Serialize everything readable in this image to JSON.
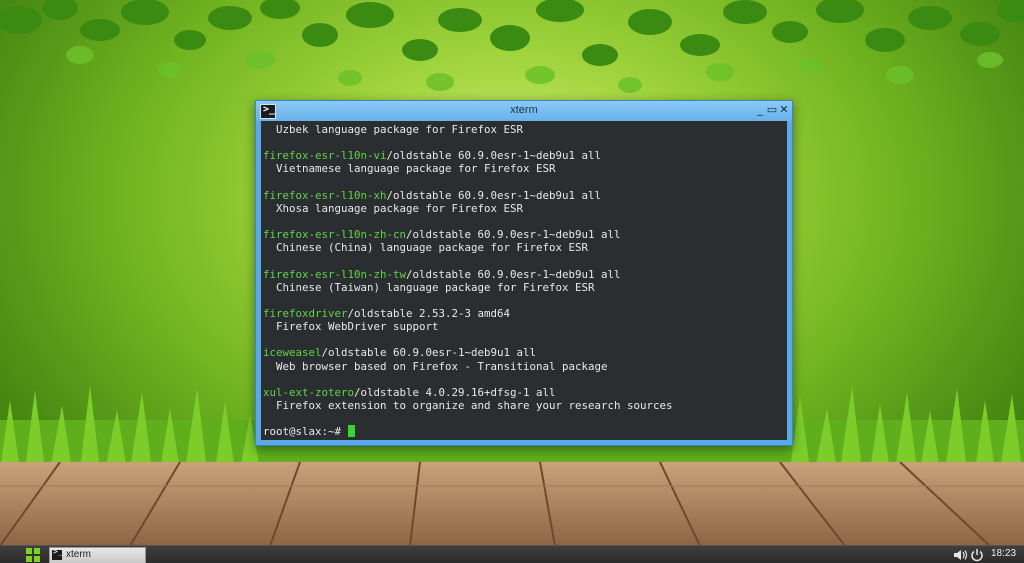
{
  "window": {
    "title": "xterm",
    "controls": {
      "minimize": "_",
      "maximize": "▭",
      "close": "✕"
    },
    "title_icon": "terminal-icon"
  },
  "terminal": {
    "lines": [
      {
        "pkg": "",
        "rest": "  Uzbek language package for Firefox ESR"
      },
      {
        "pkg": "",
        "rest": ""
      },
      {
        "pkg": "firefox-esr-l10n-vi",
        "rest": "/oldstable 60.9.0esr-1~deb9u1 all"
      },
      {
        "pkg": "",
        "rest": "  Vietnamese language package for Firefox ESR"
      },
      {
        "pkg": "",
        "rest": ""
      },
      {
        "pkg": "firefox-esr-l10n-xh",
        "rest": "/oldstable 60.9.0esr-1~deb9u1 all"
      },
      {
        "pkg": "",
        "rest": "  Xhosa language package for Firefox ESR"
      },
      {
        "pkg": "",
        "rest": ""
      },
      {
        "pkg": "firefox-esr-l10n-zh-cn",
        "rest": "/oldstable 60.9.0esr-1~deb9u1 all"
      },
      {
        "pkg": "",
        "rest": "  Chinese (China) language package for Firefox ESR"
      },
      {
        "pkg": "",
        "rest": ""
      },
      {
        "pkg": "firefox-esr-l10n-zh-tw",
        "rest": "/oldstable 60.9.0esr-1~deb9u1 all"
      },
      {
        "pkg": "",
        "rest": "  Chinese (Taiwan) language package for Firefox ESR"
      },
      {
        "pkg": "",
        "rest": ""
      },
      {
        "pkg": "firefoxdriver",
        "rest": "/oldstable 2.53.2-3 amd64"
      },
      {
        "pkg": "",
        "rest": "  Firefox WebDriver support"
      },
      {
        "pkg": "",
        "rest": ""
      },
      {
        "pkg": "iceweasel",
        "rest": "/oldstable 60.9.0esr-1~deb9u1 all"
      },
      {
        "pkg": "",
        "rest": "  Web browser based on Firefox - Transitional package"
      },
      {
        "pkg": "",
        "rest": ""
      },
      {
        "pkg": "xul-ext-zotero",
        "rest": "/oldstable 4.0.29.16+dfsg-1 all"
      },
      {
        "pkg": "",
        "rest": "  Firefox extension to organize and share your research sources"
      },
      {
        "pkg": "",
        "rest": ""
      },
      {
        "pkg": "",
        "rest": "root@slax:~# "
      }
    ],
    "colors": {
      "background": "#2b2e30",
      "text": "#e8e8e8",
      "package": "#5fd34a",
      "cursor": "#33d633"
    }
  },
  "taskbar": {
    "start_icon": "apps-grid-icon",
    "tasks": [
      {
        "label": "xterm",
        "icon": "terminal-icon"
      }
    ],
    "tray": {
      "volume_icon": "volume-icon",
      "power_icon": "power-icon",
      "clock": "18:23"
    }
  }
}
